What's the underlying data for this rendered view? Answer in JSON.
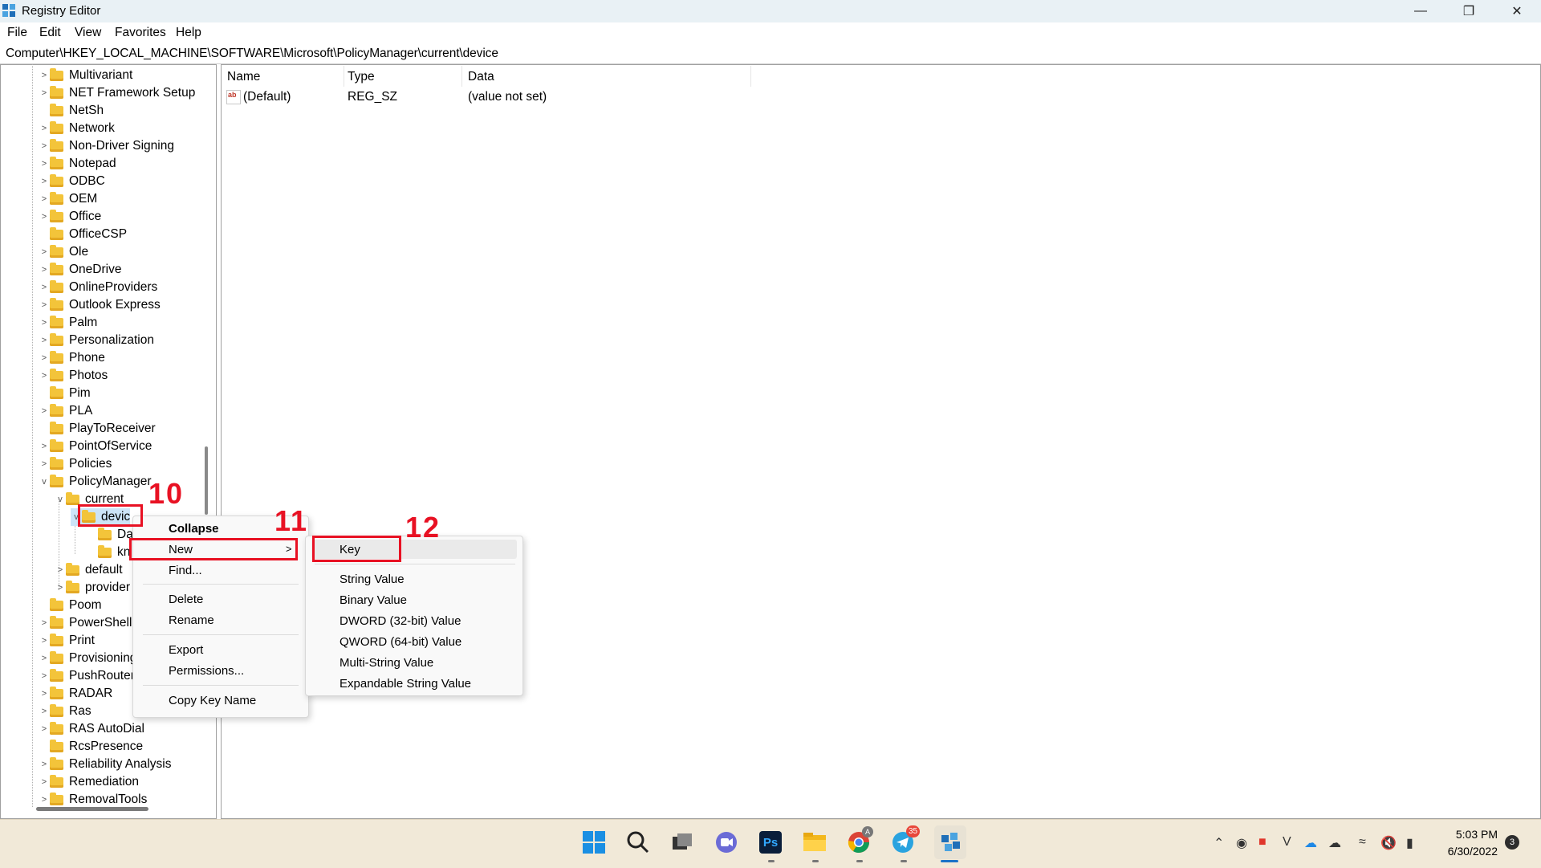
{
  "window": {
    "title": "Registry Editor",
    "minimize": "—",
    "restore": "❐",
    "close": "✕"
  },
  "menu": [
    "File",
    "Edit",
    "View",
    "Favorites",
    "Help"
  ],
  "address": "Computer\\HKEY_LOCAL_MACHINE\\SOFTWARE\\Microsoft\\PolicyManager\\current\\device",
  "tree": [
    {
      "label": "Multivariant",
      "level": 0,
      "expander": ">"
    },
    {
      "label": "NET Framework Setup",
      "level": 0,
      "expander": ">"
    },
    {
      "label": "NetSh",
      "level": 0,
      "expander": ""
    },
    {
      "label": "Network",
      "level": 0,
      "expander": ">"
    },
    {
      "label": "Non-Driver Signing",
      "level": 0,
      "expander": ">"
    },
    {
      "label": "Notepad",
      "level": 0,
      "expander": ">"
    },
    {
      "label": "ODBC",
      "level": 0,
      "expander": ">"
    },
    {
      "label": "OEM",
      "level": 0,
      "expander": ">"
    },
    {
      "label": "Office",
      "level": 0,
      "expander": ">"
    },
    {
      "label": "OfficeCSP",
      "level": 0,
      "expander": ""
    },
    {
      "label": "Ole",
      "level": 0,
      "expander": ">"
    },
    {
      "label": "OneDrive",
      "level": 0,
      "expander": ">"
    },
    {
      "label": "OnlineProviders",
      "level": 0,
      "expander": ">"
    },
    {
      "label": "Outlook Express",
      "level": 0,
      "expander": ">"
    },
    {
      "label": "Palm",
      "level": 0,
      "expander": ">"
    },
    {
      "label": "Personalization",
      "level": 0,
      "expander": ">"
    },
    {
      "label": "Phone",
      "level": 0,
      "expander": ">"
    },
    {
      "label": "Photos",
      "level": 0,
      "expander": ">"
    },
    {
      "label": "Pim",
      "level": 0,
      "expander": ""
    },
    {
      "label": "PLA",
      "level": 0,
      "expander": ">"
    },
    {
      "label": "PlayToReceiver",
      "level": 0,
      "expander": ""
    },
    {
      "label": "PointOfService",
      "level": 0,
      "expander": ">"
    },
    {
      "label": "Policies",
      "level": 0,
      "expander": ">"
    },
    {
      "label": "PolicyManager",
      "level": 0,
      "expander": "v"
    },
    {
      "label": "current",
      "level": 1,
      "expander": "v"
    },
    {
      "label": "devic",
      "level": 2,
      "expander": "v"
    },
    {
      "label": "Da",
      "level": 3,
      "expander": ""
    },
    {
      "label": "kn",
      "level": 3,
      "expander": ""
    },
    {
      "label": "default",
      "level": 1,
      "expander": ">"
    },
    {
      "label": "provider",
      "level": 1,
      "expander": ">"
    },
    {
      "label": "Poom",
      "level": 0,
      "expander": ""
    },
    {
      "label": "PowerShell",
      "level": 0,
      "expander": ">"
    },
    {
      "label": "Print",
      "level": 0,
      "expander": ">"
    },
    {
      "label": "Provisioning",
      "level": 0,
      "expander": ">"
    },
    {
      "label": "PushRouter",
      "level": 0,
      "expander": ">"
    },
    {
      "label": "RADAR",
      "level": 0,
      "expander": ">"
    },
    {
      "label": "Ras",
      "level": 0,
      "expander": ">"
    },
    {
      "label": "RAS AutoDial",
      "level": 0,
      "expander": ">"
    },
    {
      "label": "RcsPresence",
      "level": 0,
      "expander": ""
    },
    {
      "label": "Reliability Analysis",
      "level": 0,
      "expander": ">"
    },
    {
      "label": "Remediation",
      "level": 0,
      "expander": ">"
    },
    {
      "label": "RemovalTools",
      "level": 0,
      "expander": ">"
    }
  ],
  "list": {
    "headers": {
      "name": "Name",
      "type": "Type",
      "data": "Data"
    },
    "rows": [
      {
        "name": "(Default)",
        "type": "REG_SZ",
        "data": "(value not set)",
        "icon": "ab"
      }
    ]
  },
  "context_menu": {
    "collapse": "Collapse",
    "new": "New",
    "new_arrow": ">",
    "find": "Find...",
    "delete": "Delete",
    "rename": "Rename",
    "export": "Export",
    "permissions": "Permissions...",
    "copy_key_name": "Copy Key Name"
  },
  "submenu": {
    "key": "Key",
    "string_value": "String Value",
    "binary_value": "Binary Value",
    "dword": "DWORD (32-bit) Value",
    "qword": "QWORD (64-bit) Value",
    "multi_string": "Multi-String Value",
    "expandable_string": "Expandable String Value"
  },
  "annotations": {
    "step10": "10",
    "step11": "11",
    "step12": "12",
    "color": "#e81123"
  },
  "taskbar": {
    "apps": [
      "windows-start-icon",
      "search-icon",
      "task-view-icon",
      "chat-icon",
      "photoshop-icon",
      "file-explorer-icon",
      "chrome-icon",
      "telegram-icon",
      "registry-editor-icon"
    ],
    "photoshop_label": "Ps",
    "chrome_badge": "A",
    "telegram_badge": "35",
    "time": "5:03 PM",
    "date": "6/30/2022",
    "notification_count": "3",
    "tray_icons": [
      "chevron-up-icon",
      "eye-icon",
      "app-icon",
      "v-icon",
      "onedrive-icon",
      "cloud-icon",
      "wifi-icon",
      "mute-icon",
      "battery-icon"
    ]
  }
}
